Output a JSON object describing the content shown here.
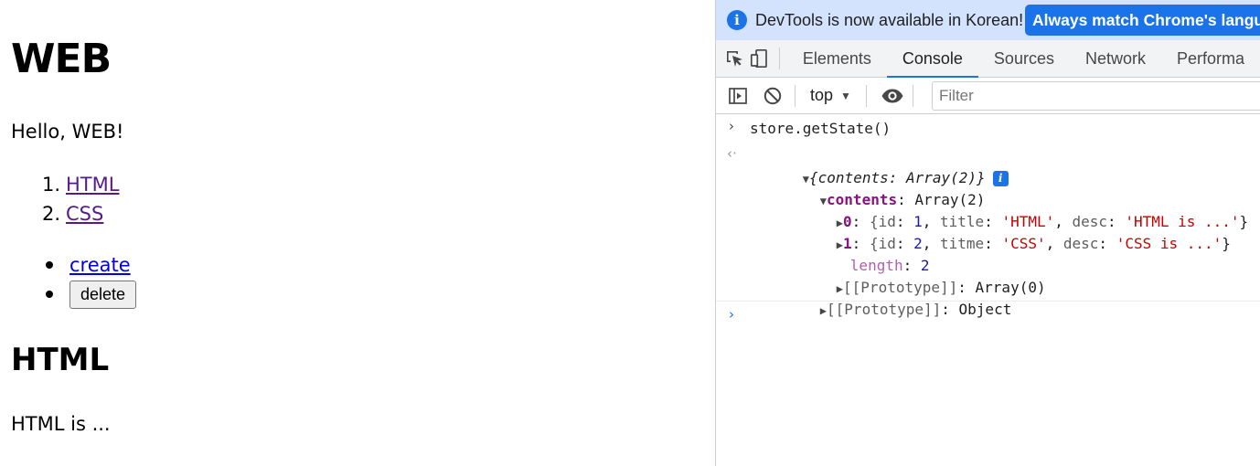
{
  "page": {
    "title": "WEB",
    "greeting": "Hello, WEB!",
    "topics": [
      {
        "num": "1.",
        "label": "HTML"
      },
      {
        "num": "2.",
        "label": "CSS"
      }
    ],
    "create_label": "create",
    "delete_label": "delete",
    "article_title": "HTML",
    "article_desc": "HTML is ..."
  },
  "devtools": {
    "infobar": {
      "text": "DevTools is now available in Korean!",
      "button_label": "Always match Chrome's langua"
    },
    "tabs": [
      "Elements",
      "Console",
      "Sources",
      "Network",
      "Performa"
    ],
    "active_tab": "Console",
    "toolbar": {
      "context": "top",
      "filter_placeholder": "Filter"
    },
    "console": {
      "command": "store.getState()",
      "result_summary": "{contents: Array(2)}",
      "contents_key": "contents",
      "contents_value": "Array(2)",
      "item0": {
        "index": "0",
        "id": "1",
        "title_key": "title",
        "title": "'HTML'",
        "desc": "'HTML is ...'"
      },
      "item1": {
        "index": "1",
        "id": "2",
        "title_key": "titme",
        "title": "'CSS'",
        "desc": "'CSS is ...'"
      },
      "length_key": "length",
      "length_value": "2",
      "array_proto": "[[Prototype]]",
      "array_proto_value": "Array(0)",
      "object_proto": "[[Prototype]]",
      "object_proto_value": "Object"
    }
  },
  "colors": {
    "accent": "#1a73e8",
    "infobar_bg": "#d3e3fd",
    "visited_link": "#551a8b",
    "link": "#0000ee"
  }
}
